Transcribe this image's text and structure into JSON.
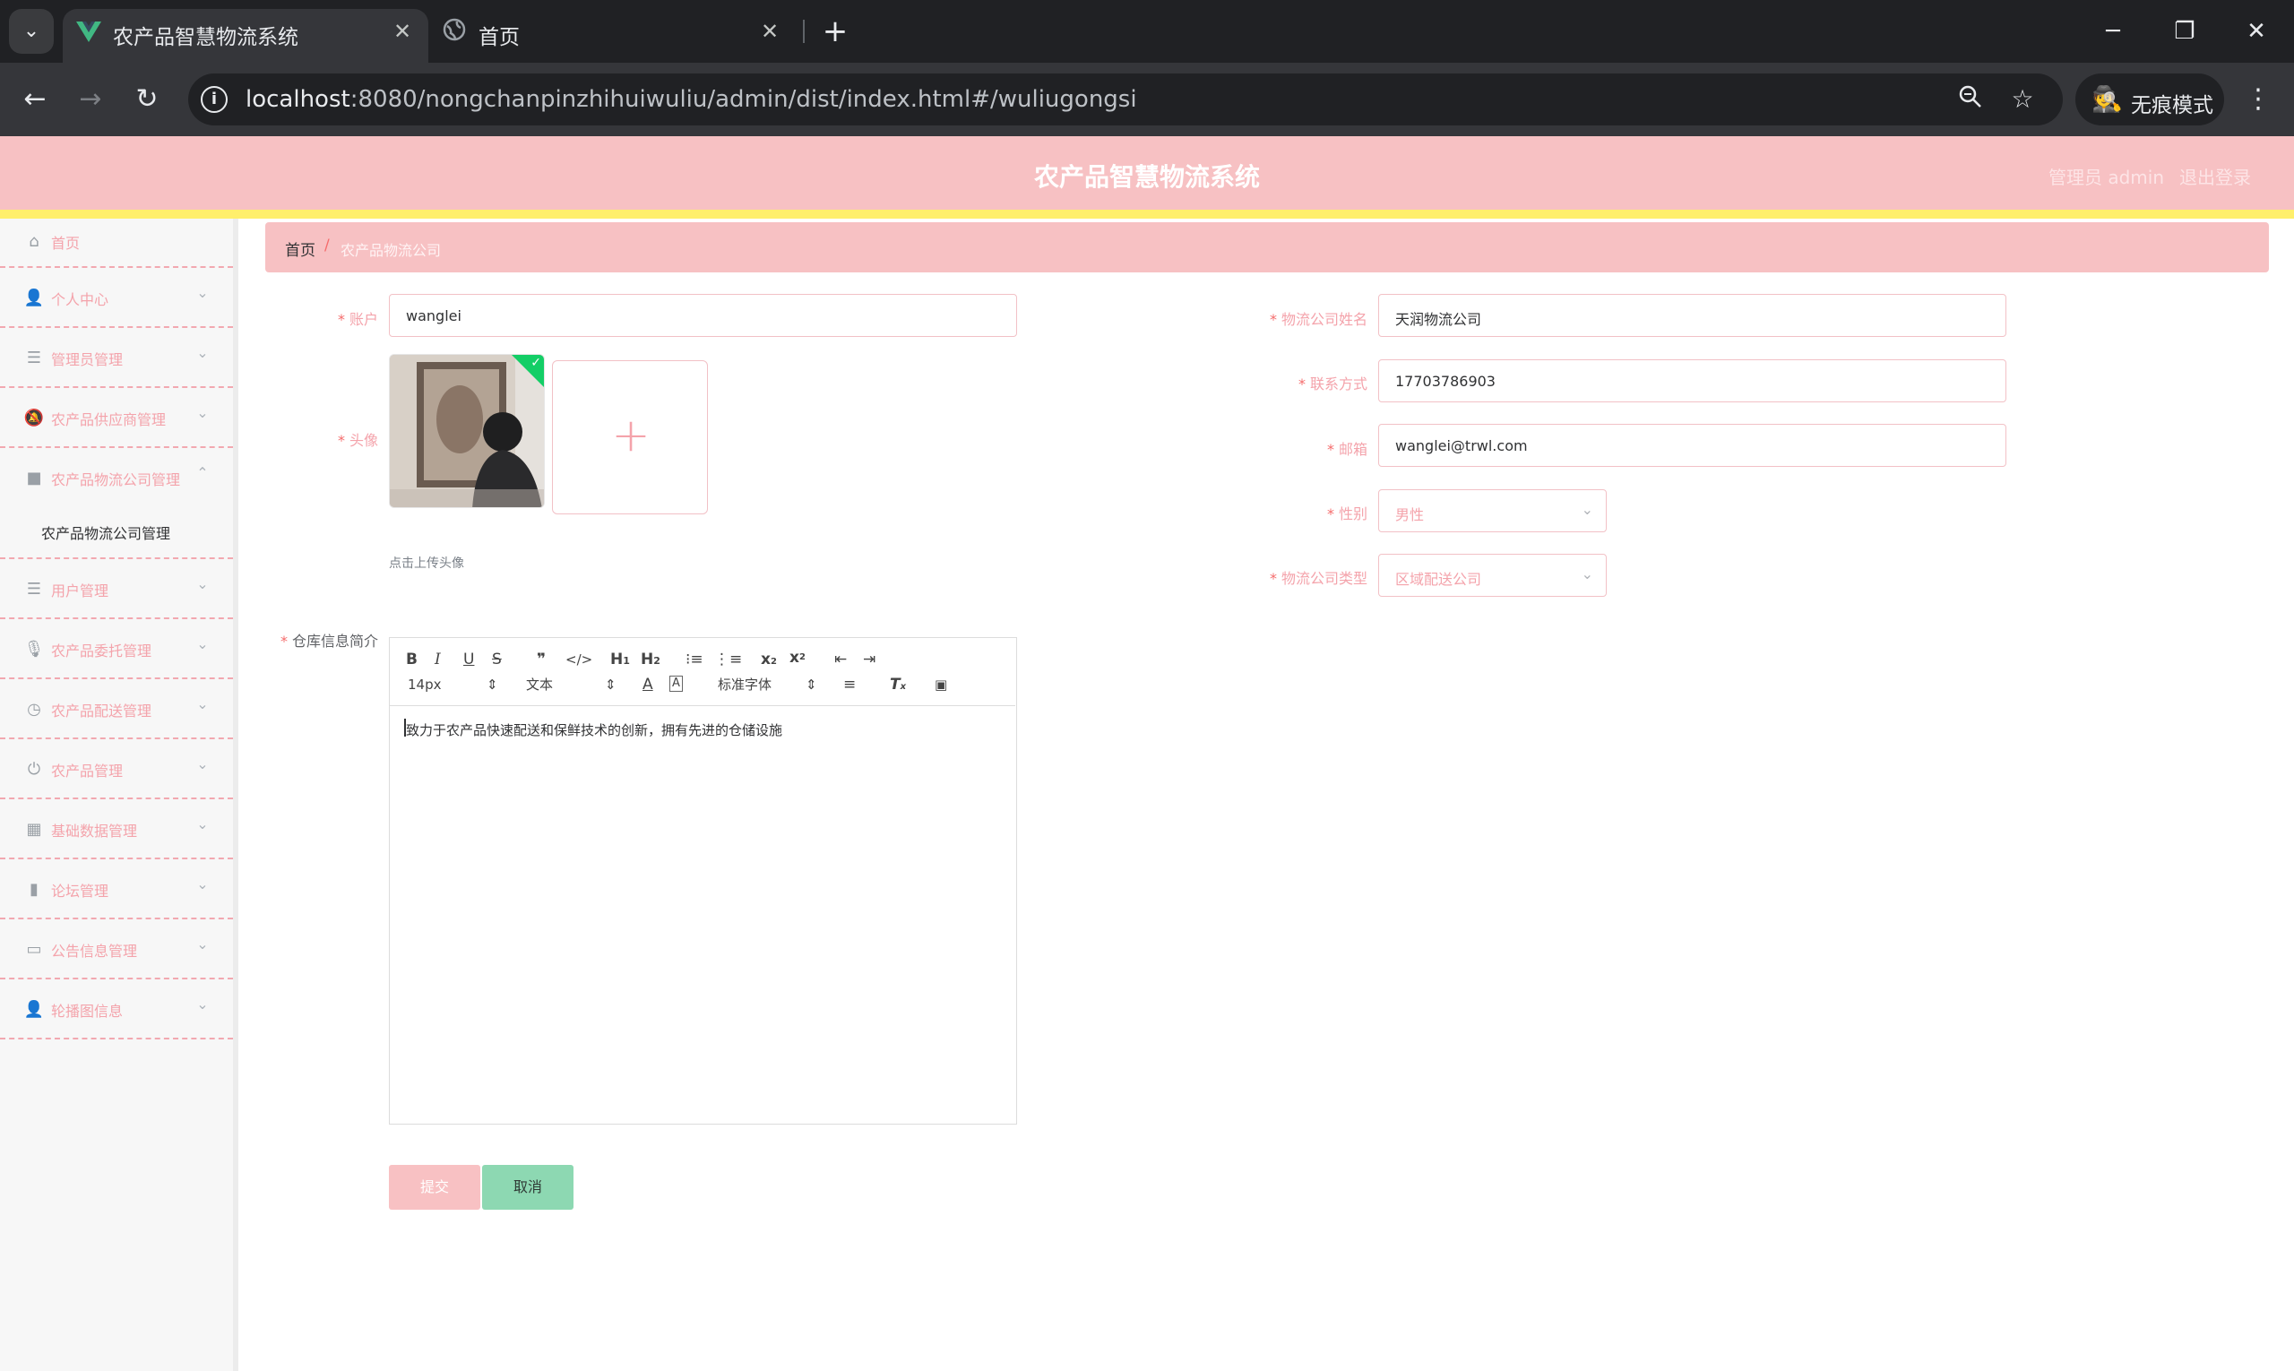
{
  "browser": {
    "tabs": [
      {
        "title": "农产品智慧物流系统",
        "active": true
      },
      {
        "title": "首页",
        "active": false
      }
    ],
    "url_host": "localhost",
    "url_rest": ":8080/nongchanpinzhihuiwuliu/admin/dist/index.html#/wuliugongsi",
    "incognito_label": "无痕模式"
  },
  "header": {
    "title": "农产品智慧物流系统",
    "admin_label": "管理员 admin",
    "logout_label": "退出登录"
  },
  "sidebar": {
    "items": [
      {
        "label": "首页",
        "icon": "home-icon"
      },
      {
        "label": "个人中心",
        "icon": "user-icon"
      },
      {
        "label": "管理员管理",
        "icon": "menu-icon"
      },
      {
        "label": "农产品供应商管理",
        "icon": "bell-off-icon"
      },
      {
        "label": "农产品物流公司管理",
        "icon": "video-camera-icon"
      },
      {
        "label": "用户管理",
        "icon": "menu-icon"
      },
      {
        "label": "农产品委托管理",
        "icon": "microphone-icon"
      },
      {
        "label": "农产品配送管理",
        "icon": "clock-icon"
      },
      {
        "label": "农产品管理",
        "icon": "power-icon"
      },
      {
        "label": "基础数据管理",
        "icon": "grid-icon"
      },
      {
        "label": "论坛管理",
        "icon": "bar-chart-icon"
      },
      {
        "label": "公告信息管理",
        "icon": "notice-icon"
      },
      {
        "label": "轮播图信息",
        "icon": "user-icon"
      }
    ],
    "submenu_label": "农产品物流公司管理"
  },
  "breadcrumb": {
    "home": "首页",
    "separator": "/",
    "current": "农产品物流公司"
  },
  "form": {
    "account_label": "账户",
    "account_value": "wanglei",
    "avatar_label": "头像",
    "upload_tip": "点击上传头像",
    "company_name_label": "物流公司姓名",
    "company_name_value": "天润物流公司",
    "contact_label": "联系方式",
    "contact_value": "17703786903",
    "email_label": "邮箱",
    "email_value": "wanglei@trwl.com",
    "gender_label": "性别",
    "gender_value": "男性",
    "company_type_label": "物流公司类型",
    "company_type_value": "区域配送公司",
    "intro_label": "仓库信息简介",
    "intro_value": "致力于农产品快速配送和保鲜技术的创新，拥有先进的仓储设施"
  },
  "editor_toolbar": {
    "font_size": "14px",
    "header_select": "文本",
    "font_family": "标准字体"
  },
  "buttons": {
    "submit": "提交",
    "cancel": "取消"
  },
  "colors": {
    "header_bg": "#f7c1c3",
    "header_stripe": "#ffef6b",
    "label_pink": "#f4a3ab",
    "success_green": "#13ce66",
    "cancel_green": "#8dd8b2"
  }
}
